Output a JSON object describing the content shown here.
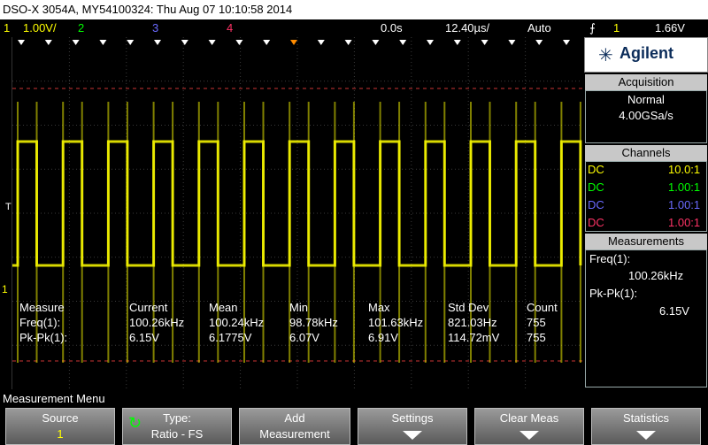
{
  "title_bar": "DSO-X 3054A, MY54100324: Thu Aug 07 10:10:58 2014",
  "status": {
    "ch1_num": "1",
    "ch1_scale": "1.00V/",
    "ch2_num": "2",
    "ch3_num": "3",
    "ch4_num": "4",
    "time_delay": "0.0s",
    "time_scale": "12.40µs/",
    "trigger_mode": "Auto",
    "trigger_ch": "1",
    "trigger_level": "1.66V"
  },
  "trigger_marker": "T",
  "ground_marker": "1",
  "panel": {
    "logo": "Agilent",
    "acquisition_header": "Acquisition",
    "acq_mode": "Normal",
    "sample_rate": "4.00GSa/s",
    "channels_header": "Channels",
    "channels": [
      {
        "coupling": "DC",
        "ratio": "10.0:1",
        "color": "#ffff00"
      },
      {
        "coupling": "DC",
        "ratio": "1.00:1",
        "color": "#00ff00"
      },
      {
        "coupling": "DC",
        "ratio": "1.00:1",
        "color": "#6a6aff"
      },
      {
        "coupling": "DC",
        "ratio": "1.00:1",
        "color": "#ff3366"
      }
    ],
    "measurements_header": "Measurements",
    "freq_label": "Freq(1):",
    "freq_value": "100.26kHz",
    "pkpk_label": "Pk-Pk(1):",
    "pkpk_value": "6.15V"
  },
  "measure_table": {
    "headers": [
      "Measure",
      "Current",
      "Mean",
      "Min",
      "Max",
      "Std Dev",
      "Count"
    ],
    "rows": [
      [
        "Freq(1):",
        "100.26kHz",
        "100.24kHz",
        "98.78kHz",
        "101.63kHz",
        "821.03Hz",
        "755"
      ],
      [
        "Pk-Pk(1):",
        "6.15V",
        "6.1775V",
        "6.07V",
        "6.91V",
        "114.72mV",
        "755"
      ]
    ]
  },
  "menu_title": "Measurement Menu",
  "softkeys": [
    {
      "l1": "Source",
      "l2": "1"
    },
    {
      "l1": "Type:",
      "l2": "Ratio - FS"
    },
    {
      "l1": "Add",
      "l2": "Measurement"
    },
    {
      "l1": "Settings",
      "l2": ""
    },
    {
      "l1": "Clear Meas",
      "l2": ""
    },
    {
      "l1": "Statistics",
      "l2": ""
    }
  ],
  "colors": {
    "trace": "#ffff00",
    "grid": "#3a3a3a",
    "cursor": "#cc3333",
    "orange_marker": "#ff8c00"
  }
}
